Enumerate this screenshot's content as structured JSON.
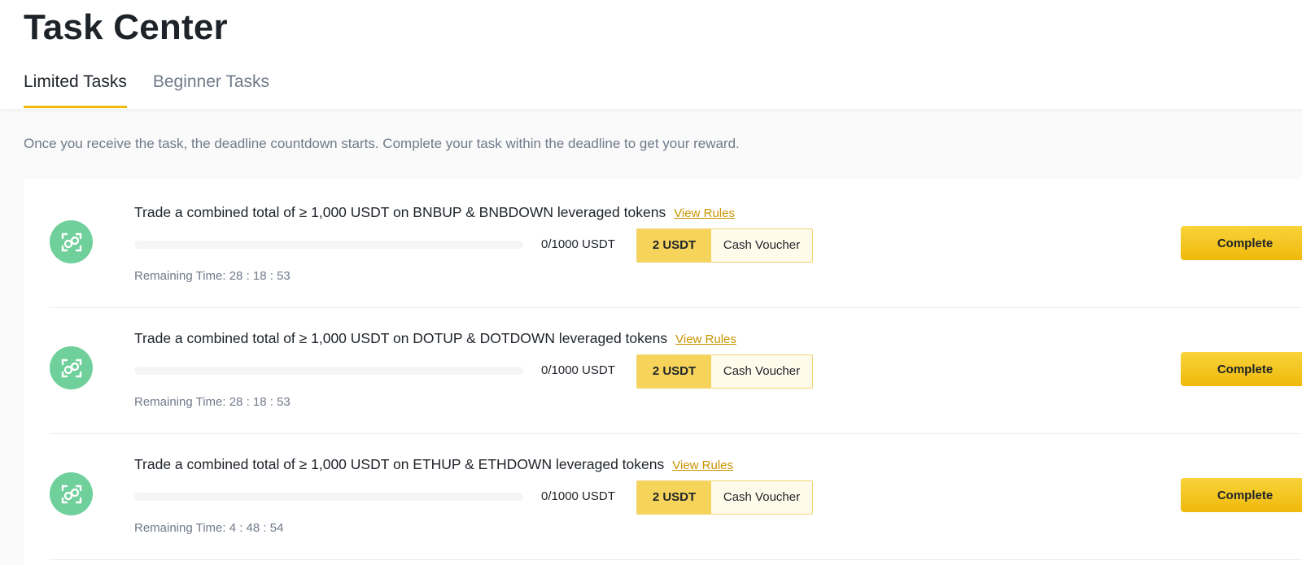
{
  "page": {
    "title": "Task Center"
  },
  "tabs": [
    {
      "label": "Limited Tasks",
      "active": true
    },
    {
      "label": "Beginner Tasks",
      "active": false
    }
  ],
  "notice": "Once you receive the task, the deadline countdown starts. Complete your task within the deadline to get your reward.",
  "colors": {
    "accent": "#f0b90b",
    "icon_bg": "#6fd09b",
    "link": "#c99400"
  },
  "tasks": [
    {
      "title": "Trade a combined total of ≥ 1,000 USDT on BNBUP & BNBDOWN leveraged tokens",
      "rules_label": "View Rules",
      "progress_text": "0/1000 USDT",
      "progress_fraction": 0,
      "reward_amount": "2 USDT",
      "reward_type": "Cash Voucher",
      "remaining": "Remaining Time: 28 : 18 : 53",
      "button_label": "Complete",
      "icon": "scan-exchange-icon"
    },
    {
      "title": "Trade a combined total of ≥ 1,000 USDT on DOTUP & DOTDOWN leveraged tokens",
      "rules_label": "View Rules",
      "progress_text": "0/1000 USDT",
      "progress_fraction": 0,
      "reward_amount": "2 USDT",
      "reward_type": "Cash Voucher",
      "remaining": "Remaining Time: 28 : 18 : 53",
      "button_label": "Complete",
      "icon": "scan-exchange-icon"
    },
    {
      "title": "Trade a combined total of ≥ 1,000 USDT on ETHUP & ETHDOWN leveraged tokens",
      "rules_label": "View Rules",
      "progress_text": "0/1000 USDT",
      "progress_fraction": 0,
      "reward_amount": "2 USDT",
      "reward_type": "Cash Voucher",
      "remaining": "Remaining Time: 4 : 48 : 54",
      "button_label": "Complete",
      "icon": "scan-exchange-icon"
    }
  ]
}
